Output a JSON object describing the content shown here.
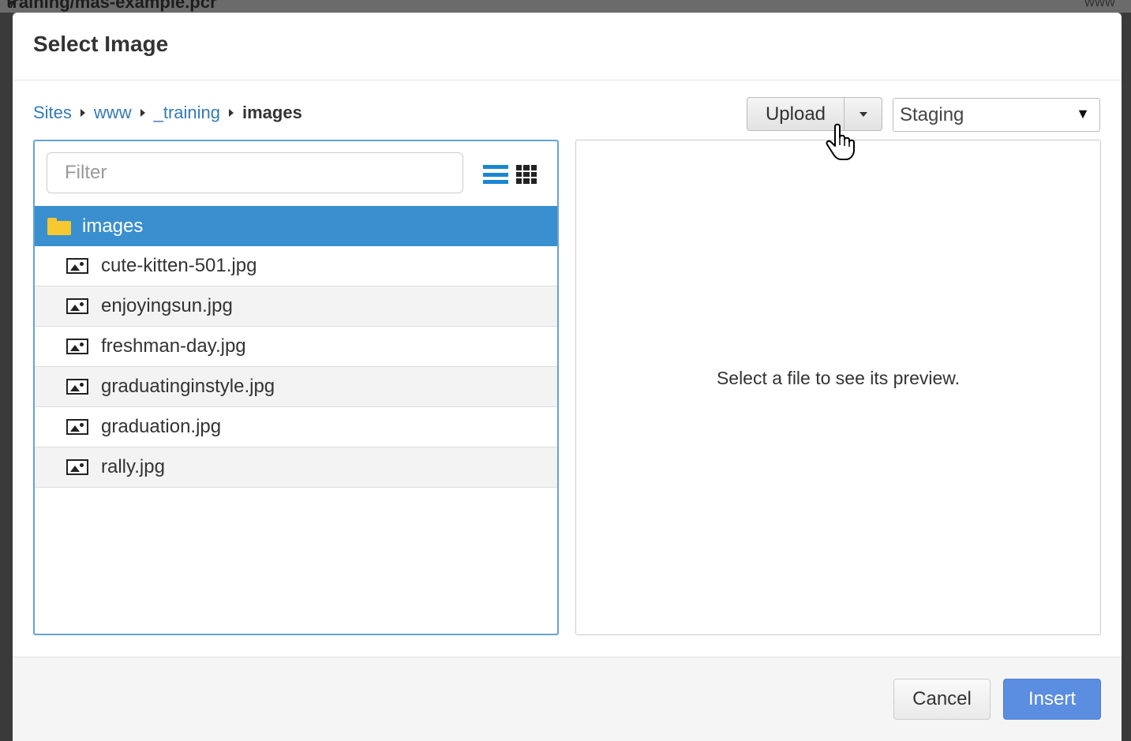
{
  "backdrop": {
    "path_text": "training/mas-example.pcr",
    "site_text": "www"
  },
  "dialog": {
    "title": "Select Image"
  },
  "breadcrumb": {
    "items": [
      "Sites",
      "www",
      "_training"
    ],
    "current": "images"
  },
  "toolbar": {
    "upload_label": "Upload",
    "environment_selected": "Staging"
  },
  "filter": {
    "placeholder": "Filter",
    "value": ""
  },
  "file_tree": {
    "folder": "images",
    "files": [
      "cute-kitten-501.jpg",
      "enjoyingsun.jpg",
      "freshman-day.jpg",
      "graduatinginstyle.jpg",
      "graduation.jpg",
      "rally.jpg"
    ]
  },
  "preview": {
    "empty_text": "Select a file to see its preview."
  },
  "footer": {
    "cancel_label": "Cancel",
    "insert_label": "Insert"
  },
  "colors": {
    "selected_row": "#3a8fce",
    "link": "#337ab7",
    "insert_button": "#5b8de0",
    "folder_icon": "#f7c830"
  }
}
